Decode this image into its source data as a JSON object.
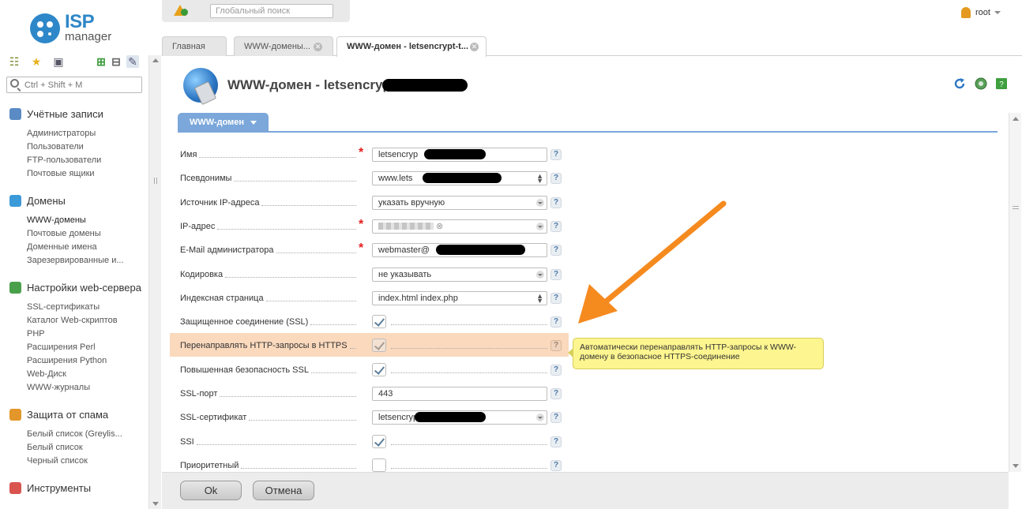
{
  "app": {
    "logo_text": "ISP",
    "logo_sub": "manager"
  },
  "topbar": {
    "search_placeholder": "Глобальный поиск",
    "user": "root"
  },
  "sidebar": {
    "search_placeholder": "Ctrl + Shift + M",
    "groups": [
      {
        "title": "Учётные записи",
        "icon": "users-icon",
        "color": "#5b8bc5",
        "items": [
          "Администраторы",
          "Пользователи",
          "FTP-пользователи",
          "Почтовые ящики"
        ]
      },
      {
        "title": "Домены",
        "icon": "domains-icon",
        "color": "#3b9ad8",
        "items": [
          "WWW-домены",
          "Почтовые домены",
          "Доменные имена",
          "Зарезервированные и..."
        ]
      },
      {
        "title": "Настройки web-сервера",
        "icon": "webserver-icon",
        "color": "#4aa04a",
        "items": [
          "SSL-сертификаты",
          "Каталог Web-скриптов",
          "PHP",
          "Расширения Perl",
          "Расширения Python",
          "Web-Диск",
          "WWW-журналы"
        ]
      },
      {
        "title": "Защита от спама",
        "icon": "spam-shield-icon",
        "color": "#e3962a",
        "items": [
          "Белый список (Greylis...",
          "Белый список",
          "Черный список"
        ]
      },
      {
        "title": "Инструменты",
        "icon": "tools-icon",
        "color": "#d9534f",
        "items": []
      }
    ]
  },
  "tabs": [
    {
      "label": "Главная",
      "closable": false,
      "active": false
    },
    {
      "label": "WWW-домены...",
      "closable": true,
      "active": false
    },
    {
      "label": "WWW-домен - letsencrypt-t...",
      "closable": true,
      "active": true
    }
  ],
  "page": {
    "title": "WWW-домен - letsencryp",
    "form_tab": "WWW-домен"
  },
  "form": {
    "rows": [
      {
        "label": "Имя",
        "required": true,
        "type": "text",
        "value": "letsencryp"
      },
      {
        "label": "Псевдонимы",
        "required": false,
        "type": "text-spin",
        "value": "www.lets"
      },
      {
        "label": "Источник IP-адреса",
        "required": false,
        "type": "select",
        "value": "указать вручную"
      },
      {
        "label": "IP-адрес",
        "required": true,
        "type": "tag-select",
        "value": ""
      },
      {
        "label": "E-Mail администратора",
        "required": true,
        "type": "text",
        "value": "webmaster@"
      },
      {
        "label": "Кодировка",
        "required": false,
        "type": "select",
        "value": "не указывать"
      },
      {
        "label": "Индексная страница",
        "required": false,
        "type": "text-spin",
        "value": "index.html index.php"
      },
      {
        "label": "Защищенное соединение (SSL)",
        "required": false,
        "type": "checkbox",
        "checked": true
      },
      {
        "label": "Перенаправлять HTTP-запросы в HTTPS",
        "required": false,
        "type": "checkbox",
        "checked": true,
        "highlight": true
      },
      {
        "label": "Повышенная безопасность SSL",
        "required": false,
        "type": "checkbox",
        "checked": true
      },
      {
        "label": "SSL-порт",
        "required": false,
        "type": "text",
        "value": "443"
      },
      {
        "label": "SSL-сертификат",
        "required": false,
        "type": "select",
        "value": "letsencryp(letsencrypt-"
      },
      {
        "label": "SSI",
        "required": false,
        "type": "checkbox",
        "checked": true
      },
      {
        "label": "Приоритетный",
        "required": false,
        "type": "checkbox",
        "checked": false
      }
    ],
    "help_glyph": "?"
  },
  "tooltip": {
    "text": "Автоматически перенаправлять HTTP-запросы к WWW-домену в безопасное HTTPS-соединение"
  },
  "footer": {
    "ok_label": "Ok",
    "cancel_label": "Отмена"
  },
  "colors": {
    "accent": "#7ba7da",
    "highlight_row": "#fbd9bd",
    "tooltip_bg": "#fdf58f",
    "arrow": "#f58a1f",
    "required": "#e32020"
  }
}
